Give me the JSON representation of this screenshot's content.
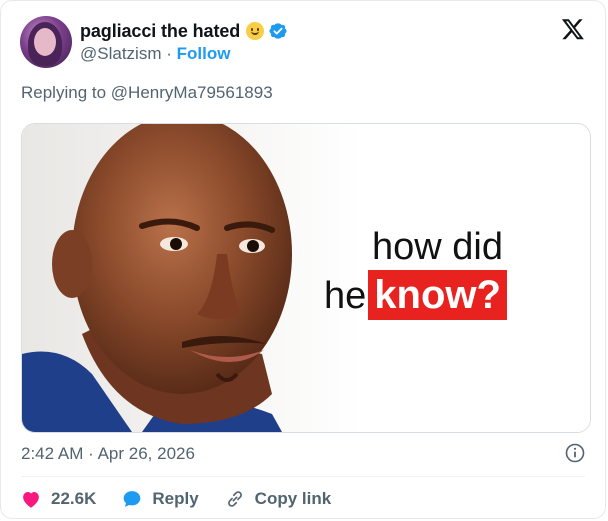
{
  "author": {
    "name": "pagliacci the hated",
    "handle": "@Slatzism",
    "separator": "·",
    "follow_label": "Follow"
  },
  "reply_context": {
    "prefix": "Replying to",
    "mention": "@HenryMa79561893"
  },
  "media": {
    "meme_line1": "how did",
    "meme_line2_prefix": "he",
    "meme_line2_highlight": "know?"
  },
  "meta": {
    "time": "2:42 AM",
    "separator": "·",
    "date": "Apr 26, 2026"
  },
  "actions": {
    "likes": "22.6K",
    "reply_label": "Reply",
    "copy_label": "Copy link"
  },
  "colors": {
    "accent": "#1d9bf0",
    "like": "#f91880",
    "muted": "#536471",
    "highlight": "#e8231f"
  },
  "icons": [
    "x-logo-icon",
    "verified-badge-icon",
    "smiley-emoji-icon",
    "info-icon",
    "heart-icon",
    "reply-bubble-icon",
    "link-icon"
  ]
}
